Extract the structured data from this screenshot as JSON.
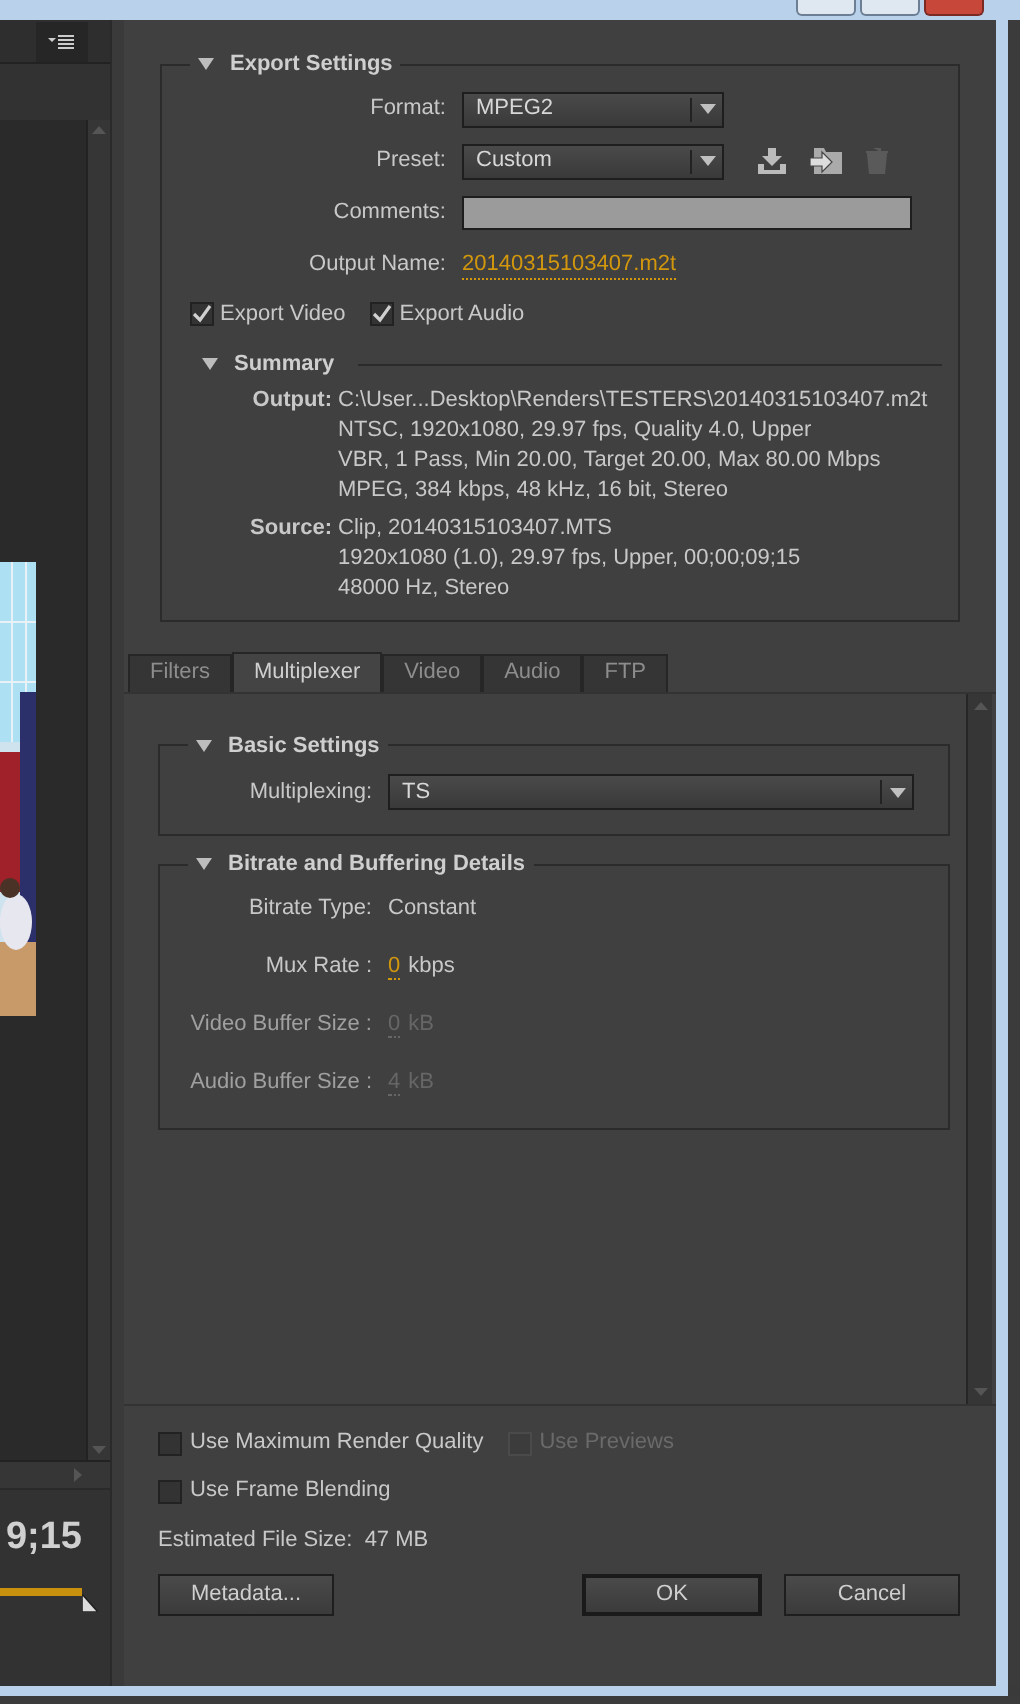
{
  "source_panel": {
    "timecode": "9;15"
  },
  "export_settings": {
    "title": "Export Settings",
    "expanded": true,
    "fields": [
      {
        "kind": "dropdown",
        "label": "Format:",
        "value": "MPEG2"
      },
      {
        "kind": "preset",
        "label": "Preset:",
        "value": "Custom"
      },
      {
        "kind": "text",
        "label": "Comments:"
      },
      {
        "kind": "link",
        "label": "Output Name:",
        "value": "20140315103407.m2t"
      }
    ],
    "checkboxes": [
      {
        "label": "Export Video",
        "checked": true
      },
      {
        "label": "Export Audio",
        "checked": true
      }
    ],
    "summary": {
      "title": "Summary",
      "expanded": true,
      "entries": [
        {
          "label": "Output:",
          "lines": [
            "C:\\User...Desktop\\Renders\\TESTERS\\20140315103407.m2t",
            "NTSC, 1920x1080, 29.97 fps, Quality 4.0, Upper",
            "VBR, 1 Pass, Min 20.00, Target 20.00, Max 80.00 Mbps",
            "MPEG, 384 kbps, 48 kHz, 16 bit, Stereo"
          ]
        },
        {
          "label": "Source:",
          "lines": [
            "Clip, 20140315103407.MTS",
            "1920x1080 (1.0), 29.97 fps, Upper, 00;00;09;15",
            "48000 Hz, Stereo"
          ]
        }
      ]
    }
  },
  "tabs": [
    {
      "label": "Filters",
      "selected": false
    },
    {
      "label": "Multiplexer",
      "selected": true
    },
    {
      "label": "Video",
      "selected": false
    },
    {
      "label": "Audio",
      "selected": false
    },
    {
      "label": "FTP",
      "selected": false
    }
  ],
  "basic_settings": {
    "title": "Basic Settings",
    "expanded": true,
    "label": "Multiplexing:",
    "value": "TS"
  },
  "bitrate_details": {
    "title": "Bitrate and Buffering Details",
    "expanded": true,
    "rows": [
      {
        "kind": "text",
        "label": "Bitrate Type:",
        "value": "Constant",
        "disabled": false
      },
      {
        "kind": "number",
        "label": "Mux Rate :",
        "value": "0",
        "unit": "kbps",
        "disabled": false
      },
      {
        "kind": "number",
        "label": "Video Buffer Size :",
        "value": "0",
        "unit": "kB",
        "disabled": true
      },
      {
        "kind": "number",
        "label": "Audio Buffer Size :",
        "value": "4",
        "unit": "kB",
        "disabled": true
      }
    ]
  },
  "options": [
    [
      {
        "label": "Use Maximum Render Quality",
        "checked": false,
        "disabled": false
      },
      {
        "label": "Use Previews",
        "checked": false,
        "disabled": true
      }
    ],
    [
      {
        "label": "Use Frame Blending",
        "checked": false,
        "disabled": false
      }
    ]
  ],
  "estimated_file_size": "Estimated File Size:  47 MB",
  "buttons": [
    {
      "label": "Metadata...",
      "default": false
    },
    {
      "label": "OK",
      "default": true
    },
    {
      "label": "Cancel",
      "default": false
    }
  ]
}
